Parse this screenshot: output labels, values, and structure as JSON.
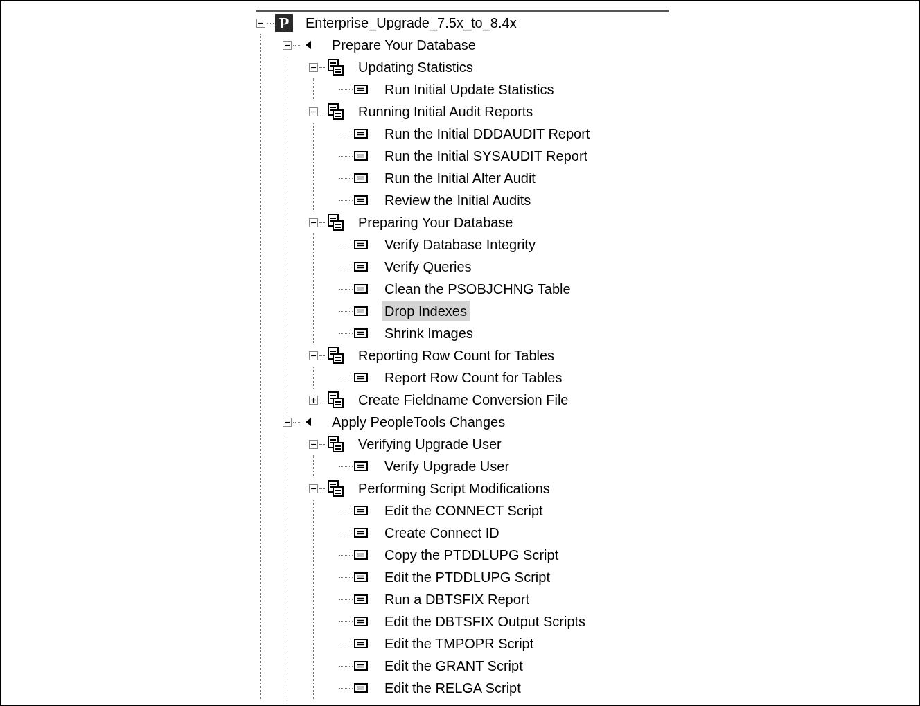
{
  "tree": [
    {
      "label": "Enterprise_Upgrade_7.5x_to_8.4x",
      "kind": "project",
      "badge": "P",
      "expanded": true,
      "selected": false,
      "children": [
        {
          "label": "Prepare Your Database",
          "kind": "phase",
          "expanded": true,
          "selected": false,
          "children": [
            {
              "label": "Updating Statistics",
              "kind": "task",
              "expanded": true,
              "selected": false,
              "children": [
                {
                  "label": "Run Initial Update Statistics",
                  "kind": "step",
                  "selected": false
                }
              ]
            },
            {
              "label": "Running Initial Audit Reports",
              "kind": "task",
              "expanded": true,
              "selected": false,
              "children": [
                {
                  "label": "Run the Initial DDDAUDIT Report",
                  "kind": "step",
                  "selected": false
                },
                {
                  "label": "Run the Initial SYSAUDIT Report",
                  "kind": "step",
                  "selected": false
                },
                {
                  "label": "Run the Initial Alter Audit",
                  "kind": "step",
                  "selected": false
                },
                {
                  "label": "Review the Initial Audits",
                  "kind": "step",
                  "selected": false
                }
              ]
            },
            {
              "label": "Preparing Your Database",
              "kind": "task",
              "expanded": true,
              "selected": false,
              "children": [
                {
                  "label": "Verify Database Integrity",
                  "kind": "step",
                  "selected": false
                },
                {
                  "label": "Verify Queries",
                  "kind": "step",
                  "selected": false
                },
                {
                  "label": "Clean the PSOBJCHNG Table",
                  "kind": "step",
                  "selected": false
                },
                {
                  "label": "Drop Indexes",
                  "kind": "step",
                  "selected": true
                },
                {
                  "label": "Shrink Images",
                  "kind": "step",
                  "selected": false
                }
              ]
            },
            {
              "label": "Reporting Row Count for Tables",
              "kind": "task",
              "expanded": true,
              "selected": false,
              "children": [
                {
                  "label": "Report Row Count for Tables",
                  "kind": "step",
                  "selected": false
                }
              ]
            },
            {
              "label": "Create Fieldname Conversion File",
              "kind": "task",
              "expanded": false,
              "selected": false
            }
          ]
        },
        {
          "label": "Apply PeopleTools Changes",
          "kind": "phase",
          "expanded": true,
          "selected": false,
          "children": [
            {
              "label": "Verifying Upgrade User",
              "kind": "task",
              "expanded": true,
              "selected": false,
              "children": [
                {
                  "label": "Verify Upgrade User",
                  "kind": "step",
                  "selected": false
                }
              ]
            },
            {
              "label": "Performing Script Modifications",
              "kind": "task",
              "expanded": true,
              "selected": false,
              "children": [
                {
                  "label": "Edit the CONNECT Script",
                  "kind": "step",
                  "selected": false
                },
                {
                  "label": "Create Connect ID",
                  "kind": "step",
                  "selected": false
                },
                {
                  "label": "Copy the PTDDLUPG Script",
                  "kind": "step",
                  "selected": false
                },
                {
                  "label": "Edit the PTDDLUPG Script",
                  "kind": "step",
                  "selected": false
                },
                {
                  "label": "Run a DBTSFIX Report",
                  "kind": "step",
                  "selected": false
                },
                {
                  "label": "Edit the DBTSFIX Output Scripts",
                  "kind": "step",
                  "selected": false
                },
                {
                  "label": "Edit the TMPOPR Script",
                  "kind": "step",
                  "selected": false
                },
                {
                  "label": "Edit the GRANT Script",
                  "kind": "step",
                  "selected": false
                },
                {
                  "label": "Edit the RELGA Script",
                  "kind": "step",
                  "selected": false
                }
              ]
            }
          ]
        }
      ]
    }
  ]
}
